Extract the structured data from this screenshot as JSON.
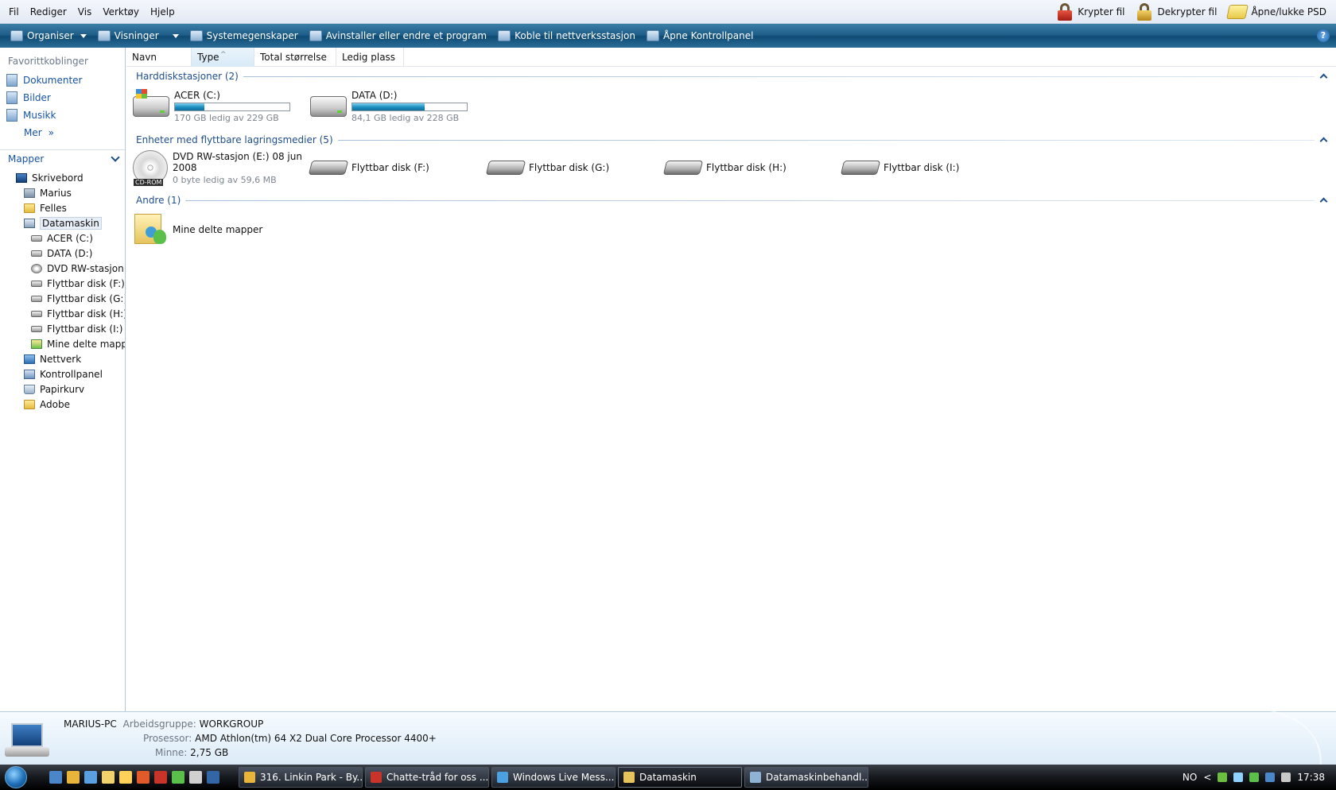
{
  "menubar": {
    "menus": [
      "Fil",
      "Rediger",
      "Vis",
      "Verktøy",
      "Hjelp"
    ],
    "tools": [
      {
        "label": "Krypter fil",
        "icon": "red-lock-icon"
      },
      {
        "label": "Dekrypter fil",
        "icon": "gold-lock-icon"
      },
      {
        "label": "Åpne/lukke PSD",
        "icon": "psd-icon"
      }
    ]
  },
  "cmdbar": {
    "organize": "Organiser",
    "views": "Visninger",
    "system_props": "Systemegenskaper",
    "uninstall": "Avinstaller eller endre et program",
    "map_drive": "Koble til nettverksstasjon",
    "open_cpl": "Åpne Kontrollpanel",
    "help": "?"
  },
  "nav": {
    "favorites_header": "Favorittkoblinger",
    "favorites": [
      "Dokumenter",
      "Bilder",
      "Musikk"
    ],
    "more": "Mer",
    "more_glyph": "»",
    "folders_header": "Mapper",
    "tree": [
      {
        "label": "Skrivebord",
        "icon": "desk",
        "level": 1
      },
      {
        "label": "Marius",
        "icon": "user",
        "level": 2
      },
      {
        "label": "Felles",
        "icon": "folder",
        "level": 2
      },
      {
        "label": "Datamaskin",
        "icon": "comp",
        "level": 2,
        "selected": true
      },
      {
        "label": "ACER (C:)",
        "icon": "drive",
        "level": 3
      },
      {
        "label": "DATA (D:)",
        "icon": "drive",
        "level": 3
      },
      {
        "label": "DVD RW-stasjon (",
        "icon": "cd",
        "level": 3
      },
      {
        "label": "Flyttbar disk (F:)",
        "icon": "drive",
        "level": 3
      },
      {
        "label": "Flyttbar disk (G:)",
        "icon": "drive",
        "level": 3
      },
      {
        "label": "Flyttbar disk (H:)",
        "icon": "drive",
        "level": 3
      },
      {
        "label": "Flyttbar disk (I:)",
        "icon": "drive",
        "level": 3
      },
      {
        "label": "Mine delte mappe",
        "icon": "share",
        "level": 3
      },
      {
        "label": "Nettverk",
        "icon": "net",
        "level": 2
      },
      {
        "label": "Kontrollpanel",
        "icon": "cpl",
        "level": 2
      },
      {
        "label": "Papirkurv",
        "icon": "bin",
        "level": 2
      },
      {
        "label": "Adobe",
        "icon": "folder",
        "level": 2
      }
    ]
  },
  "columns": [
    "Navn",
    "Type",
    "Total størrelse",
    "Ledig plass"
  ],
  "groups": {
    "hdd": {
      "title": "Harddiskstasjoner (2)",
      "items": [
        {
          "name": "ACER (C:)",
          "free": "170 GB ledig av 229 GB",
          "used_fraction": 0.26
        },
        {
          "name": "DATA (D:)",
          "free": "84,1 GB ledig av 228 GB",
          "used_fraction": 0.63
        }
      ]
    },
    "removable": {
      "title": "Enheter med flyttbare lagringsmedier (5)",
      "dvd": {
        "name_line1": "DVD RW-stasjon (E:) 08 jun",
        "name_line2": "2008",
        "free": "0 byte ledig av 59,6 MB",
        "badge": "CD-ROM"
      },
      "disks": [
        "Flyttbar disk (F:)",
        "Flyttbar disk (G:)",
        "Flyttbar disk (H:)",
        "Flyttbar disk (I:)"
      ]
    },
    "other": {
      "title": "Andre (1)",
      "items": [
        "Mine delte mapper"
      ]
    }
  },
  "details": {
    "computer": "MARIUS-PC",
    "workgroup_label": "Arbeidsgruppe:",
    "workgroup": "WORKGROUP",
    "processor_label": "Prosessor:",
    "processor": "AMD Athlon(tm) 64 X2 Dual Core Processor 4400+",
    "memory_label": "Minne:",
    "memory": "2,75 GB"
  },
  "taskbar": {
    "tasks": [
      {
        "label": "316. Linkin Park - By...",
        "color": "#e8b53a"
      },
      {
        "label": "Chatte-tråd for oss ...",
        "color": "#c8332a"
      },
      {
        "label": "Windows Live Mess...",
        "color": "#4aa0e0"
      },
      {
        "label": "Datamaskin",
        "color": "#e6c45d",
        "active": true
      },
      {
        "label": "Datamaskinbehandl...",
        "color": "#8fb3d4"
      }
    ],
    "quicklaunch_colors": [
      "#4a86c8",
      "#e8b53a",
      "#5aa0e0",
      "#f2d36b",
      "#ffd15a",
      "#e05a2a",
      "#c8332a",
      "#5bc04a",
      "#d0d0d0",
      "#3465a4"
    ],
    "lang": "NO",
    "tray_arrow": "<",
    "clock": "17:38"
  }
}
